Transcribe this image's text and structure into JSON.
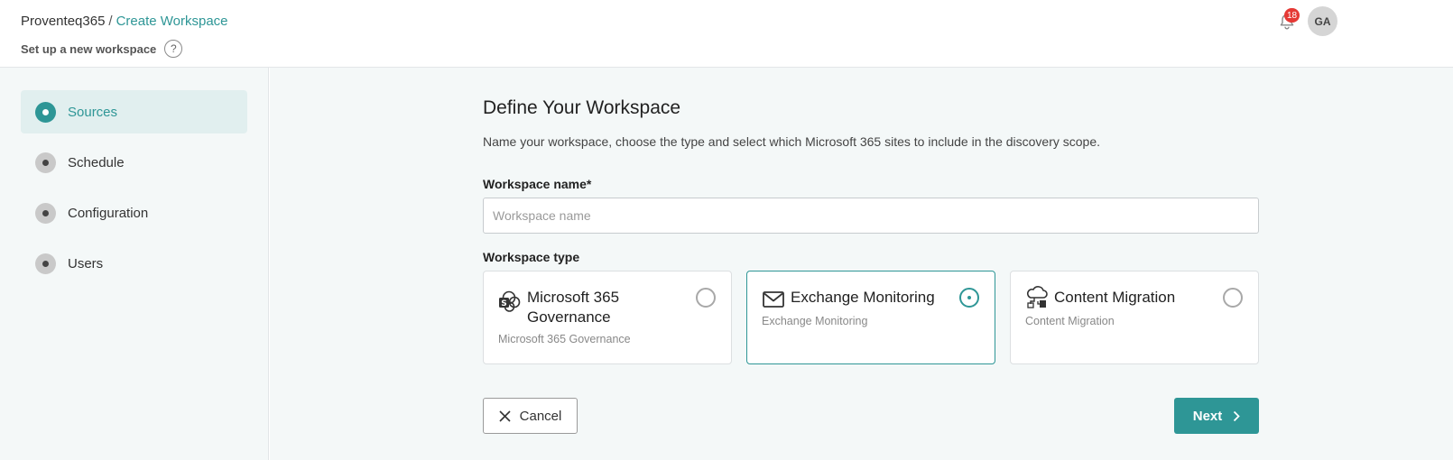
{
  "header": {
    "breadcrumb_root": "Proventeq365",
    "breadcrumb_separator": "/",
    "breadcrumb_current": "Create Workspace",
    "subtitle": "Set up a new workspace",
    "help_label": "?",
    "notification_count": "18",
    "avatar_initials": "GA"
  },
  "sidebar": {
    "steps": [
      {
        "label": "Sources",
        "active": true
      },
      {
        "label": "Schedule",
        "active": false
      },
      {
        "label": "Configuration",
        "active": false
      },
      {
        "label": "Users",
        "active": false
      }
    ]
  },
  "form": {
    "title": "Define Your Workspace",
    "description": "Name your workspace, choose the type and select which Microsoft 365 sites to include in the discovery scope.",
    "name_label": "Workspace name*",
    "name_placeholder": "Workspace name",
    "name_value": "",
    "type_label": "Workspace type",
    "types": [
      {
        "title": "Microsoft 365 Governance",
        "subtitle": "Microsoft 365 Governance",
        "icon": "sharepoint-icon",
        "selected": false
      },
      {
        "title": "Exchange Monitoring",
        "subtitle": "Exchange Monitoring",
        "icon": "mail-icon",
        "selected": true
      },
      {
        "title": "Content Migration",
        "subtitle": "Content Migration",
        "icon": "cloud-migration-icon",
        "selected": false
      }
    ]
  },
  "actions": {
    "cancel_label": "Cancel",
    "next_label": "Next"
  },
  "colors": {
    "accent": "#2e9696",
    "badge": "#e53935"
  }
}
